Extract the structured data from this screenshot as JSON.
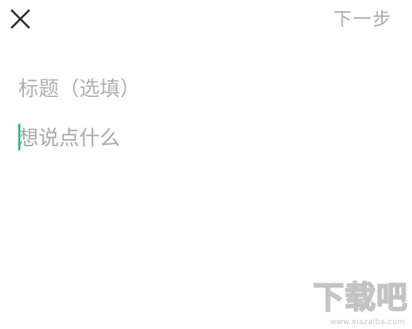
{
  "header": {
    "close_icon": "close-icon",
    "next_label": "下一步"
  },
  "editor": {
    "title_placeholder": "标题（选填）",
    "body_placeholder": "想说点什么",
    "caret_color": "#1fbf78"
  },
  "watermark": {
    "logo_text": "下载吧",
    "url": "www.xiazaiba.com"
  }
}
